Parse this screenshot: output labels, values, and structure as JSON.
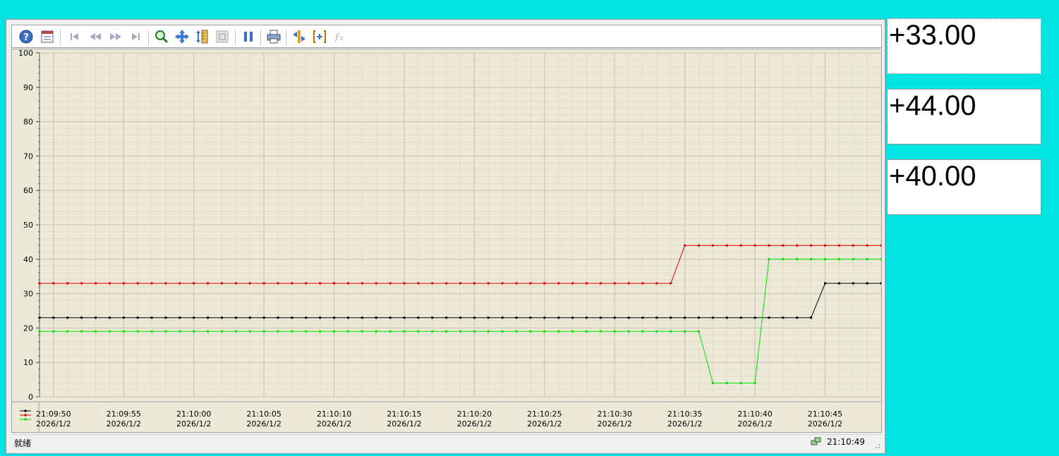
{
  "status": {
    "text": "就绪",
    "clock": "21:10:49"
  },
  "value_boxes": [
    "+33.00",
    "+44.00",
    "+40.00"
  ],
  "toolbar": {
    "buttons": [
      "help-icon",
      "properties-icon",
      "first-icon",
      "rewind-icon",
      "forward-icon",
      "last-icon",
      "zoom-icon",
      "pan-icon",
      "scale-icon",
      "reset-zoom-icon",
      "pause-icon",
      "print-icon",
      "cursor-icon",
      "range-icon",
      "formula-icon"
    ]
  },
  "colors": {
    "background": "#00e3e3",
    "plot": "#ece9d8",
    "series": [
      "#000000",
      "#e00000",
      "#00e000"
    ]
  },
  "chart_data": {
    "type": "line",
    "title": "",
    "xlabel": "",
    "ylabel": "",
    "ylim": [
      0,
      100
    ],
    "y_ticks": [
      "100",
      "90",
      "80",
      "70",
      "60",
      "50",
      "40",
      "30",
      "20",
      "10",
      "0"
    ],
    "x_ticks": [
      {
        "time": "21:09:50",
        "date": "2026/1/2"
      },
      {
        "time": "21:09:55",
        "date": "2026/1/2"
      },
      {
        "time": "21:10:00",
        "date": "2026/1/2"
      },
      {
        "time": "21:10:05",
        "date": "2026/1/2"
      },
      {
        "time": "21:10:10",
        "date": "2026/1/2"
      },
      {
        "time": "21:10:15",
        "date": "2026/1/2"
      },
      {
        "time": "21:10:20",
        "date": "2026/1/2"
      },
      {
        "time": "21:10:25",
        "date": "2026/1/2"
      },
      {
        "time": "21:10:30",
        "date": "2026/1/2"
      },
      {
        "time": "21:10:35",
        "date": "2026/1/2"
      },
      {
        "time": "21:10:40",
        "date": "2026/1/2"
      },
      {
        "time": "21:10:45",
        "date": "2026/1/2"
      }
    ],
    "grid": true,
    "legend": "bottom-left",
    "x_start": "21:09:49",
    "x_end": "21:10:49",
    "sample_interval_s": 1,
    "series": [
      {
        "color": "#000000",
        "values": [
          23,
          23,
          23,
          23,
          23,
          23,
          23,
          23,
          23,
          23,
          23,
          23,
          23,
          23,
          23,
          23,
          23,
          23,
          23,
          23,
          23,
          23,
          23,
          23,
          23,
          23,
          23,
          23,
          23,
          23,
          23,
          23,
          23,
          23,
          23,
          23,
          23,
          23,
          23,
          23,
          23,
          23,
          23,
          23,
          23,
          23,
          23,
          23,
          23,
          23,
          23,
          23,
          23,
          23,
          23,
          23,
          33,
          33,
          33,
          33,
          33
        ]
      },
      {
        "color": "#e00000",
        "values": [
          33,
          33,
          33,
          33,
          33,
          33,
          33,
          33,
          33,
          33,
          33,
          33,
          33,
          33,
          33,
          33,
          33,
          33,
          33,
          33,
          33,
          33,
          33,
          33,
          33,
          33,
          33,
          33,
          33,
          33,
          33,
          33,
          33,
          33,
          33,
          33,
          33,
          33,
          33,
          33,
          33,
          33,
          33,
          33,
          33,
          33,
          44,
          44,
          44,
          44,
          44,
          44,
          44,
          44,
          44,
          44,
          44,
          44,
          44,
          44,
          44
        ]
      },
      {
        "color": "#00e000",
        "values": [
          19,
          19,
          19,
          19,
          19,
          19,
          19,
          19,
          19,
          19,
          19,
          19,
          19,
          19,
          19,
          19,
          19,
          19,
          19,
          19,
          19,
          19,
          19,
          19,
          19,
          19,
          19,
          19,
          19,
          19,
          19,
          19,
          19,
          19,
          19,
          19,
          19,
          19,
          19,
          19,
          19,
          19,
          19,
          19,
          19,
          19,
          19,
          19,
          4,
          4,
          4,
          4,
          40,
          40,
          40,
          40,
          40,
          40,
          40,
          40,
          40
        ]
      }
    ]
  }
}
